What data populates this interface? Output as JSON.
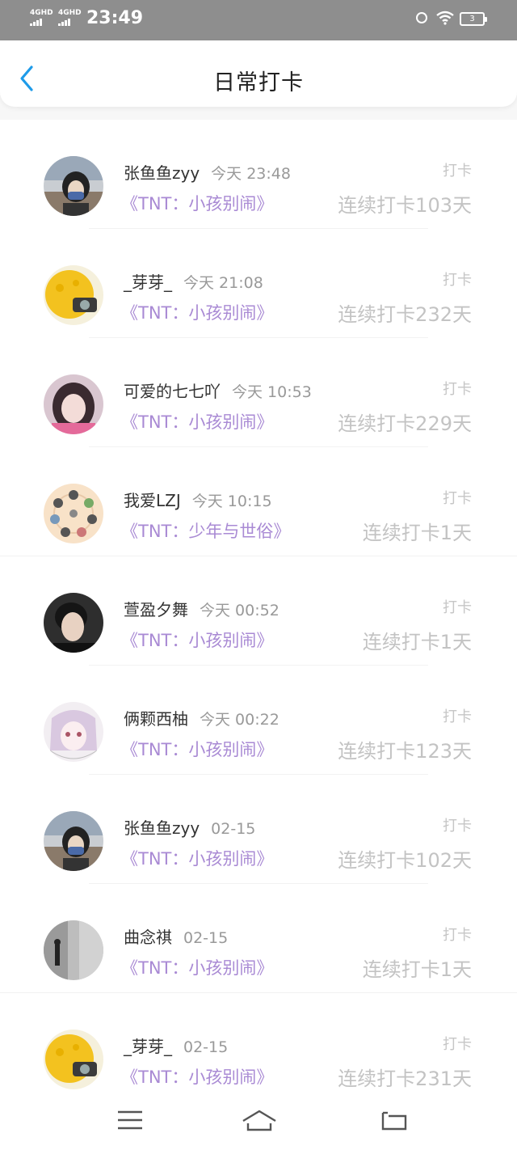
{
  "status": {
    "signal1": "4GHD",
    "signal2": "4GHD",
    "time": "23:49",
    "battery": "3"
  },
  "header": {
    "title": "日常打卡"
  },
  "items": [
    {
      "name": "张鱼鱼zyy",
      "time": "今天 23:48",
      "book": "《TNT：小孩别闹》",
      "punch": "打卡",
      "streak": "连续打卡103天",
      "avatar": "avatar-photo-girl-beach"
    },
    {
      "name": "_芽芽_",
      "time": "今天 21:08",
      "book": "《TNT：小孩别闹》",
      "punch": "打卡",
      "streak": "连续打卡232天",
      "avatar": "avatar-yellow-plush-camera"
    },
    {
      "name": "可爱的七七吖",
      "time": "今天 10:53",
      "book": "《TNT：小孩别闹》",
      "punch": "打卡",
      "streak": "连续打卡229天",
      "avatar": "avatar-photo-girl"
    },
    {
      "name": "我爱LZJ",
      "time": "今天 10:15",
      "book": "《TNT：少年与世俗》",
      "punch": "打卡",
      "streak": "连续打卡1天",
      "avatar": "avatar-cartoon-circle"
    },
    {
      "name": "萱盈夕舞",
      "time": "今天 00:52",
      "book": "《TNT：小孩别闹》",
      "punch": "打卡",
      "streak": "连续打卡1天",
      "avatar": "avatar-photo-boy"
    },
    {
      "name": "俩颗西柚",
      "time": "今天 00:22",
      "book": "《TNT：小孩别闹》",
      "punch": "打卡",
      "streak": "连续打卡123天",
      "avatar": "avatar-anime-girl"
    },
    {
      "name": "张鱼鱼zyy",
      "time": "02-15",
      "book": "《TNT：小孩别闹》",
      "punch": "打卡",
      "streak": "连续打卡102天",
      "avatar": "avatar-photo-girl-beach"
    },
    {
      "name": "曲念祺",
      "time": "02-15",
      "book": "《TNT：小孩别闹》",
      "punch": "打卡",
      "streak": "连续打卡1天",
      "avatar": "avatar-photo-street"
    },
    {
      "name": "_芽芽_",
      "time": "02-15",
      "book": "《TNT：小孩别闹》",
      "punch": "打卡",
      "streak": "连续打卡231天",
      "avatar": "avatar-yellow-plush-camera"
    }
  ],
  "colors": {
    "accent_back": "#1e9be9",
    "book_text": "#a98ad4",
    "status_bar": "#8e8e8e"
  },
  "navbar": {
    "icons": [
      "menu-icon",
      "home-icon",
      "back-icon"
    ]
  }
}
